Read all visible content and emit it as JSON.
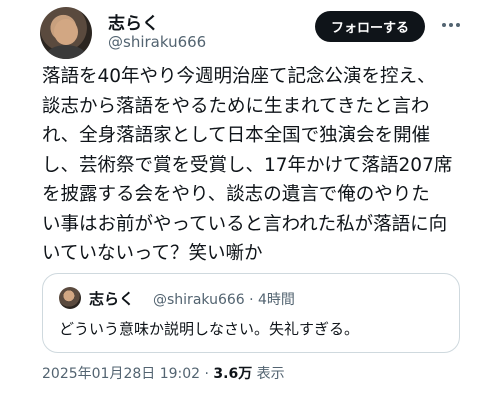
{
  "author": {
    "name": "志らく",
    "handle": "@shiraku666"
  },
  "follow_label": "フォローする",
  "body": "落語を40年やり今週明治座て記念公演を控え、\n談志から落語をやるために生まれてきたと言わ\nれ、全身落語家として日本全国で独演会を開催\nし、芸術祭で賞を受賞し、17年かけて落語207席\nを披露する会をやり、談志の遺言で俺のやりた\nい事はお前がやっていると言われた私が落語に向\nいていないって？笑い噺か",
  "quote": {
    "name": "志らく",
    "handle_time": "@shiraku666 · 4時間",
    "text": "どういう意味か説明しなさい。失礼すぎる。"
  },
  "footer": {
    "datetime": "2025年01月28日 19:02 · ",
    "views": "3.6万",
    "views_label": " 表示"
  }
}
